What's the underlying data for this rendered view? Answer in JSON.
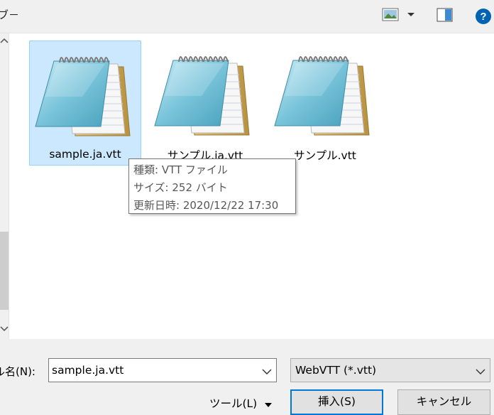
{
  "toolbar": {
    "breadcrumb_fragment": "ブ－",
    "view_icon": "view-large-icons-icon",
    "pane_icon": "preview-pane-icon",
    "help_icon": "help-icon"
  },
  "files": [
    {
      "name": "sample.ja.vtt",
      "selected": true
    },
    {
      "name": "サンプル.ja.vtt",
      "selected": false
    },
    {
      "name": "サンプル.vtt",
      "selected": false
    }
  ],
  "tooltip": {
    "type": "種類: VTT ファイル",
    "size": "サイズ: 252 バイト",
    "modified": "更新日時: 2020/12/22 17:30"
  },
  "footer": {
    "filename_label": "ル名(N):",
    "filename_value": "sample.ja.vtt",
    "filetype_selected": "WebVTT (*.vtt)",
    "tools_label": "ツール(L)",
    "insert_label": "挿入(S)",
    "cancel_label": "キャンセル"
  },
  "colors": {
    "selection_fill": "#cce8ff",
    "selection_border": "#99d1ff",
    "primary_border": "#0078d7",
    "help_blue": "#0063b1"
  }
}
